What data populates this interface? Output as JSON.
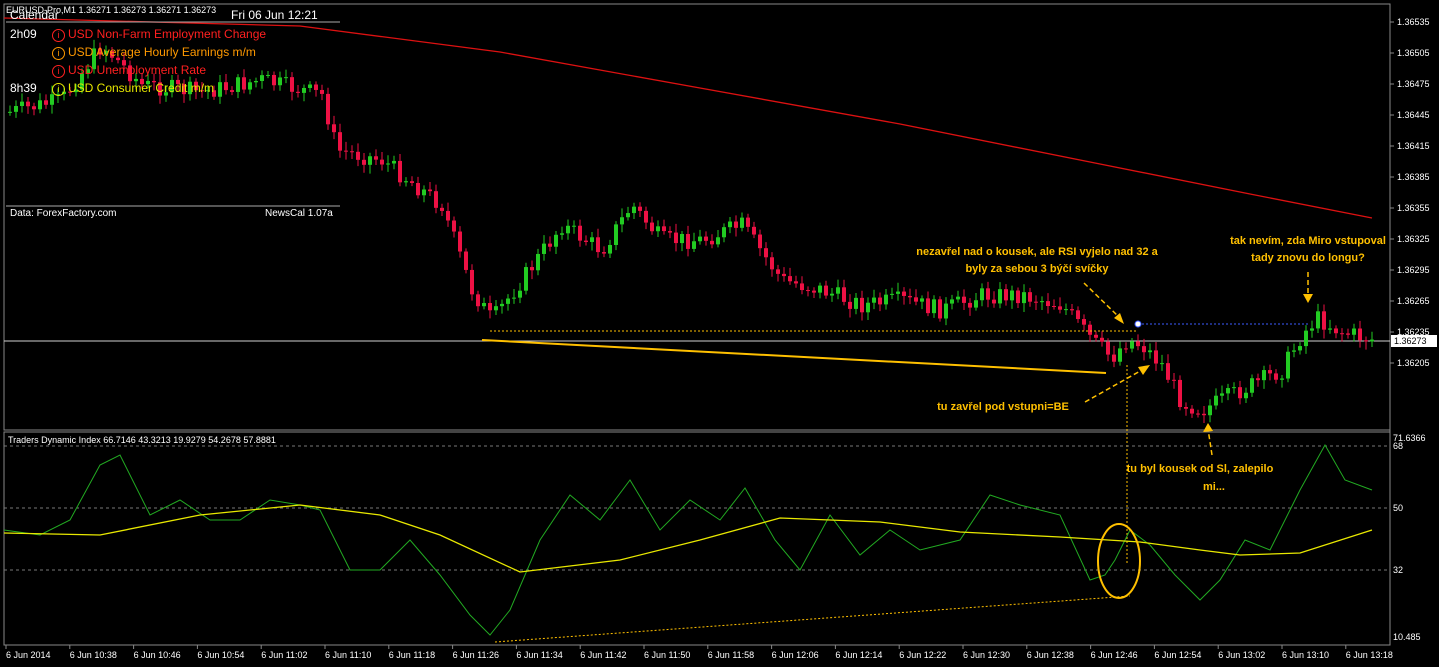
{
  "symbol_header": "EURUSD-Pro,M1  1.36271 1.36273 1.36271 1.36273",
  "calendar": {
    "title": "Calendar",
    "date": "Fri 06 Jun 12:21",
    "events": [
      {
        "time": "2h09",
        "label": "USD Non-Farm Employment Change",
        "color": "#ff2020"
      },
      {
        "time": "",
        "label": "USD Average Hourly Earnings m/m",
        "color": "#ff9900"
      },
      {
        "time": "",
        "label": "USD Unemployment Rate",
        "color": "#ff2020"
      },
      {
        "time": "8h39",
        "label": "USD Consumer Credit m/m",
        "color": "#e8e800"
      }
    ],
    "source": "Data: ForexFactory.com",
    "version": "NewsCal 1.07a"
  },
  "price_axis": {
    "ticks": [
      "1.36535",
      "1.36505",
      "1.36475",
      "1.36445",
      "1.36415",
      "1.36385",
      "1.36355",
      "1.36325",
      "1.36295",
      "1.36265",
      "1.36235",
      "1.36205"
    ],
    "current_price": "1.36273"
  },
  "indicator": {
    "title": "Traders Dynamic Index 66.7146 43.3213 19.9279 54.2678 57.8881",
    "axis_ticks": [
      "71.6366",
      "68",
      "50",
      "32",
      "10.485"
    ]
  },
  "time_axis": [
    "6 Jun 2014",
    "6 Jun 10:38",
    "6 Jun 10:46",
    "6 Jun 10:54",
    "6 Jun 11:02",
    "6 Jun 11:10",
    "6 Jun 11:18",
    "6 Jun 11:26",
    "6 Jun 11:34",
    "6 Jun 11:42",
    "6 Jun 11:50",
    "6 Jun 11:58",
    "6 Jun 12:06",
    "6 Jun 12:14",
    "6 Jun 12:22",
    "6 Jun 12:30",
    "6 Jun 12:38",
    "6 Jun 12:46",
    "6 Jun 12:54",
    "6 Jun 13:02",
    "6 Jun 13:10",
    "6 Jun 13:18"
  ],
  "annotations": {
    "a1_line1": "nezavřel nad o kousek, ale RSI vyjelo nad 32 a",
    "a1_line2": "byly za sebou 3 býčí svíčky",
    "a2": "tu zavřel pod vstupni=BE",
    "a3_line1": "tu byl kousek od Sl, zalepilo",
    "a3_line2": "mi...",
    "a4_line1": "tak nevím, zda Miro vstupoval",
    "a4_line2": "tady znovu do longu?"
  },
  "colors": {
    "bull": "#22cc22",
    "bear": "#ee1144",
    "ma": "#dd1111",
    "annotation": "#ffc000",
    "tdi_green": "#22aa22",
    "tdi_yellow": "#e8e800"
  }
}
